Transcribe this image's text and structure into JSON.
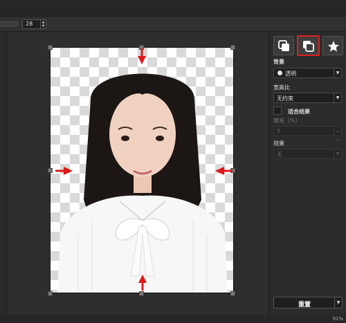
{
  "toolbar": {
    "size_value": "28",
    "spin_icon": "up-down-arrows-icon"
  },
  "panel": {
    "tabs": [
      {
        "icon": "copy-front-icon",
        "selected": false
      },
      {
        "icon": "copy-back-icon",
        "selected": true
      },
      {
        "icon": "star-icon",
        "selected": false
      }
    ],
    "background_label": "背景",
    "background_value": "透明",
    "aspect_label": "宽高比",
    "aspect_value": "无约束",
    "fit_result_label": "适合结果",
    "fill_label": "填充（%）",
    "fill_value": "5",
    "effect_label": "效果",
    "effect_value": "无",
    "reset_label": "重置"
  },
  "status": {
    "zoom": "91%"
  },
  "colors": {
    "highlight": "#e02020",
    "arrow": "#e01818",
    "panel_bg": "#2b2b2b"
  }
}
